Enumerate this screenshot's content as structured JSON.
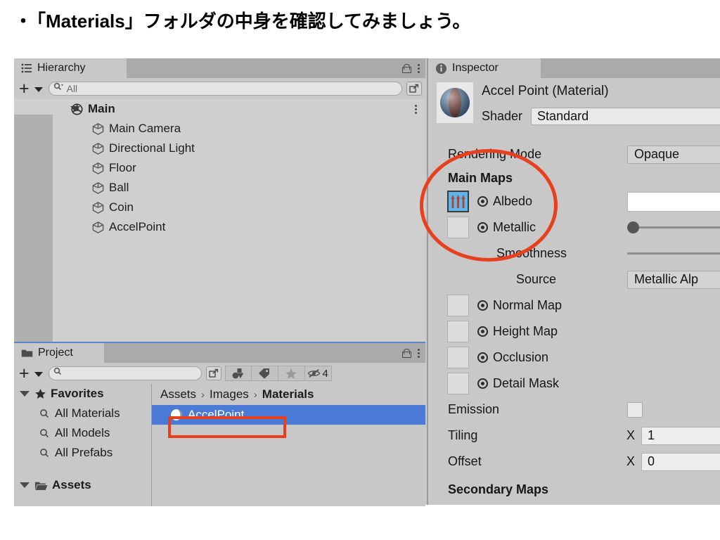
{
  "slide": {
    "bullet": "・",
    "heading": "「Materials」フォルダの中身を確認してみましょう。"
  },
  "colors": {
    "panel_bg": "#c8c8c8",
    "tabbar_bg": "#aaaaaa",
    "selection_blue": "#4a7ad6",
    "annotation_red": "#e8401f",
    "project_active_border": "#5b86c9"
  },
  "hierarchy": {
    "tab_label": "Hierarchy",
    "tab_icon": "list-icon",
    "lock_icon": "lock-icon",
    "menu_icon": "kebab-menu-icon",
    "add_button": "+",
    "add_dropdown_icon": "chevron-down-icon",
    "search": {
      "icon": "search-icon",
      "value": "All",
      "placeholder": "Search"
    },
    "expand_icon": "expand-window-icon",
    "row_menu_icon": "kebab-menu-icon",
    "root": {
      "label": "Main",
      "icon": "unity-scene-icon",
      "expanded": true,
      "fold_icon": "triangle-down-icon"
    },
    "items": [
      {
        "label": "Main Camera",
        "icon": "gameobject-cube-icon"
      },
      {
        "label": "Directional Light",
        "icon": "gameobject-cube-icon"
      },
      {
        "label": "Floor",
        "icon": "gameobject-cube-icon"
      },
      {
        "label": "Ball",
        "icon": "gameobject-cube-icon"
      },
      {
        "label": "Coin",
        "icon": "gameobject-cube-icon"
      },
      {
        "label": "AccelPoint",
        "icon": "gameobject-cube-icon"
      }
    ]
  },
  "project": {
    "tab_label": "Project",
    "tab_icon": "folder-icon",
    "lock_icon": "lock-icon",
    "menu_icon": "kebab-menu-icon",
    "add_button": "+",
    "add_dropdown_icon": "chevron-down-icon",
    "search": {
      "icon": "search-icon",
      "value": "",
      "placeholder": ""
    },
    "expand_icon": "expand-window-icon",
    "filter_buttons": [
      {
        "icon": "shapes-filter-icon",
        "label": ""
      },
      {
        "icon": "tag-label-icon",
        "label": ""
      },
      {
        "icon": "star-favorite-icon",
        "label": ""
      },
      {
        "icon": "hidden-eye-icon",
        "label": "4"
      }
    ],
    "tree": [
      {
        "label": "Favorites",
        "icon": "star-favorite-icon",
        "type": "head",
        "fold_icon": "triangle-down-icon"
      },
      {
        "label": "All Materials",
        "icon": "search-icon",
        "type": "sub"
      },
      {
        "label": "All Models",
        "icon": "search-icon",
        "type": "sub"
      },
      {
        "label": "All Prefabs",
        "icon": "search-icon",
        "type": "sub"
      },
      {
        "label": "Assets",
        "icon": "folder-open-icon",
        "type": "head",
        "fold_icon": "triangle-down-icon"
      }
    ],
    "breadcrumb": [
      {
        "label": "Assets",
        "last": false
      },
      {
        "label": "Images",
        "last": false
      },
      {
        "label": "Materials",
        "last": true
      }
    ],
    "breadcrumb_separator": "›",
    "assets": [
      {
        "label": "AccelPoint",
        "icon": "material-sphere-icon",
        "selected": true
      }
    ]
  },
  "inspector": {
    "tab_label": "Inspector",
    "tab_icon": "info-icon",
    "preview_icon": "material-sphere-preview",
    "title": "Accel Point (Material)",
    "shader_label": "Shader",
    "shader_value": "Standard",
    "rows": {
      "rendering_mode_label": "Rendering Mode",
      "rendering_mode_value": "Opaque",
      "main_maps_label": "Main Maps",
      "albedo_label": "Albedo",
      "albedo_texture_icon": "arrows-texture-thumbnail",
      "albedo_color_value": "",
      "metallic_label": "Metallic",
      "metallic_value": "0",
      "smoothness_label": "Smoothness",
      "source_label": "Source",
      "source_value": "Metallic Alp",
      "normal_map_label": "Normal Map",
      "height_map_label": "Height Map",
      "occlusion_label": "Occlusion",
      "detail_mask_label": "Detail Mask",
      "emission_label": "Emission",
      "tiling_label": "Tiling",
      "tiling_axis": "X",
      "tiling_x_value": "1",
      "offset_label": "Offset",
      "offset_axis": "X",
      "offset_x_value": "0",
      "secondary_maps_label": "Secondary Maps"
    },
    "target_picker_icon": "target-picker-icon"
  },
  "annotations": [
    {
      "name": "albedo-highlight-ellipse",
      "shape": "ellipse"
    },
    {
      "name": "accelpoint-asset-highlight-rect",
      "shape": "rect"
    }
  ]
}
